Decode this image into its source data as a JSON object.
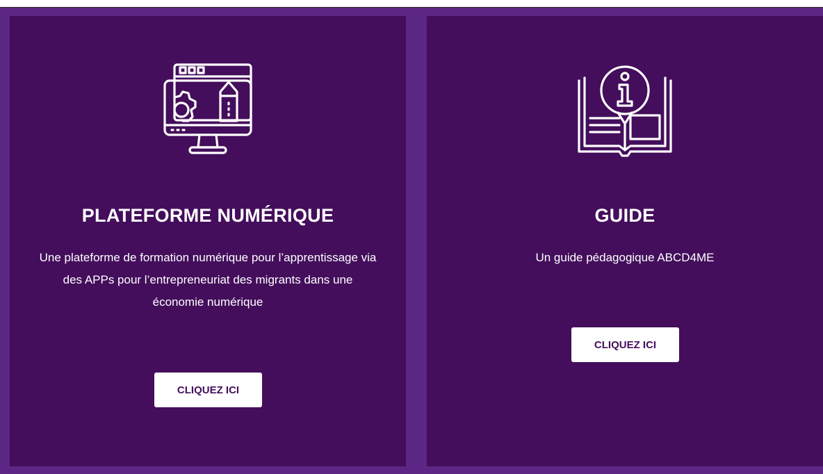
{
  "cards": [
    {
      "title": "PLATEFORME NUMÉRIQUE",
      "description": "Une plateforme de formation numérique pour l’apprentissage via des APPs pour l’entrepreneuriat des migrants dans une économie numérique",
      "button_label": "CLIQUEZ ICI",
      "icon": "computer-design-icon"
    },
    {
      "title": "GUIDE",
      "description": "Un guide pédagogique ABCD4ME",
      "button_label": "CLIQUEZ ICI",
      "icon": "info-book-icon"
    }
  ],
  "colors": {
    "frame": "#5c2685",
    "card_background": "#440e5c",
    "text": "#ffffff",
    "button_background": "#ffffff",
    "button_text": "#440e5c"
  }
}
